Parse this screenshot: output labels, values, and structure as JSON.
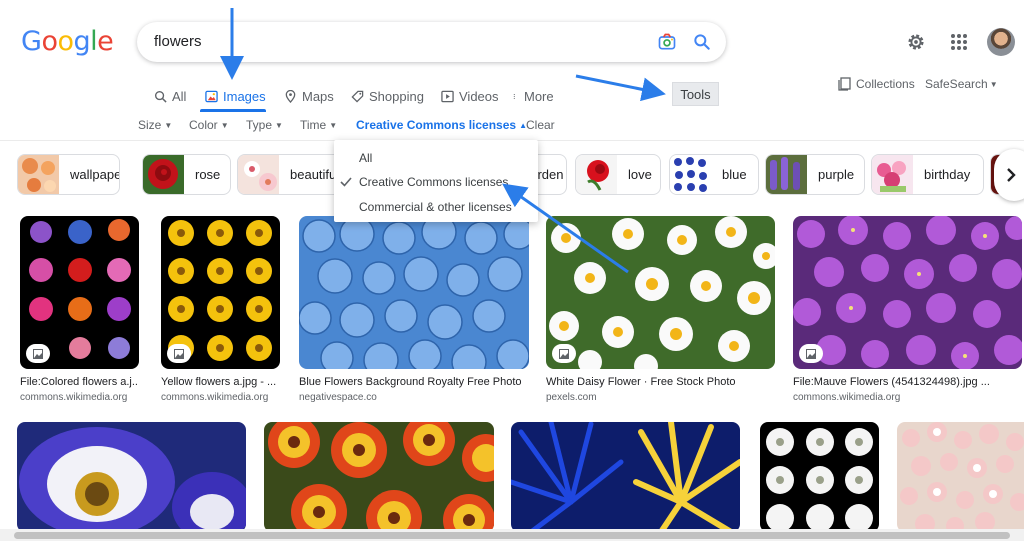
{
  "logo": {
    "letters": [
      "G",
      "o",
      "o",
      "g",
      "l",
      "e"
    ],
    "colors": [
      "#4285F4",
      "#EA4335",
      "#FBBC05",
      "#4285F4",
      "#34A853",
      "#EA4335"
    ]
  },
  "search": {
    "query": "flowers"
  },
  "tabs": [
    {
      "label": "All",
      "icon": "search-icon"
    },
    {
      "label": "Images",
      "icon": "image-icon"
    },
    {
      "label": "Maps",
      "icon": "map-pin-icon"
    },
    {
      "label": "Shopping",
      "icon": "tag-icon"
    },
    {
      "label": "Videos",
      "icon": "play-icon"
    },
    {
      "label": "More",
      "icon": "more-vert-icon"
    }
  ],
  "active_tab": "Images",
  "tools_label": "Tools",
  "collections_label": "Collections",
  "safesearch_label": "SafeSearch",
  "filters": [
    {
      "label": "Size"
    },
    {
      "label": "Color"
    },
    {
      "label": "Type"
    },
    {
      "label": "Time"
    },
    {
      "label": "Creative Commons licenses"
    },
    {
      "label": "Clear"
    }
  ],
  "chips": [
    {
      "label": "wallpaper"
    },
    {
      "label": "rose"
    },
    {
      "label": "beautiful"
    },
    {
      "label": "garden"
    },
    {
      "label": "love"
    },
    {
      "label": "blue"
    },
    {
      "label": "purple"
    },
    {
      "label": "birthday"
    }
  ],
  "license_menu": {
    "items": [
      "All",
      "Creative Commons licenses",
      "Commercial & other licenses"
    ],
    "selected": "Creative Commons licenses"
  },
  "results": [
    {
      "title": "File:Colored flowers a.j...",
      "source": "commons.wikimedia.org"
    },
    {
      "title": "Yellow flowers a.jpg - ...",
      "source": "commons.wikimedia.org"
    },
    {
      "title": "Blue Flowers Background Royalty Free Photo",
      "source": "negativespace.co"
    },
    {
      "title": "White Daisy Flower · Free Stock Photo",
      "source": "pexels.com"
    },
    {
      "title": "File:Mauve Flowers (4541324498).jpg ...",
      "source": "commons.wikimedia.org"
    }
  ],
  "colors": {
    "accent": "#1a73e8",
    "arrow": "#2b7de9"
  }
}
